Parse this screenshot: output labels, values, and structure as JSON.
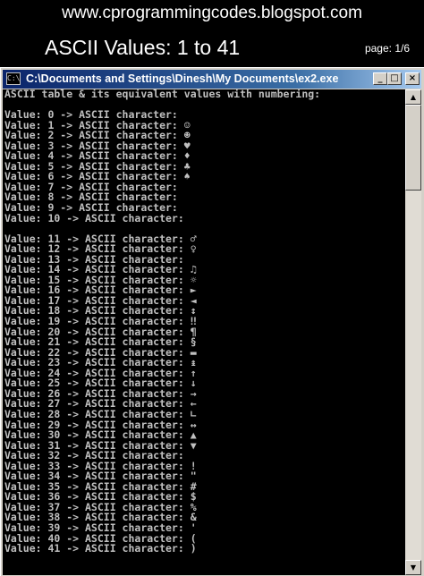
{
  "site_banner": "www.cprogrammingcodes.blogspot.com",
  "slide": {
    "title": "ASCII Values: 1 to 41",
    "page": "page: 1/6"
  },
  "window": {
    "icon_text": "C:\\",
    "title": "C:\\Documents and Settings\\Dinesh\\My Documents\\ex2.exe",
    "minimize_glyph": "_",
    "maximize_glyph": "□",
    "close_glyph": "×"
  },
  "scrollbar": {
    "up_glyph": "▲",
    "down_glyph": "▼"
  },
  "console_lines": [
    "ASCII table & its equivalent values with numbering:",
    "",
    "Value: 0 -> ASCII character:",
    "Value: 1 -> ASCII character: ☺",
    "Value: 2 -> ASCII character: ☻",
    "Value: 3 -> ASCII character: ♥",
    "Value: 4 -> ASCII character: ♦",
    "Value: 5 -> ASCII character: ♣",
    "Value: 6 -> ASCII character: ♠",
    "Value: 7 -> ASCII character:",
    "Value: 8 -> ASCII character:",
    "Value: 9 -> ASCII character:",
    "Value: 10 -> ASCII character:",
    "",
    "Value: 11 -> ASCII character: ♂",
    "Value: 12 -> ASCII character: ♀",
    "Value: 13 -> ASCII character:",
    "Value: 14 -> ASCII character: ♫",
    "Value: 15 -> ASCII character: ☼",
    "Value: 16 -> ASCII character: ►",
    "Value: 17 -> ASCII character: ◄",
    "Value: 18 -> ASCII character: ↕",
    "Value: 19 -> ASCII character: ‼",
    "Value: 20 -> ASCII character: ¶",
    "Value: 21 -> ASCII character: §",
    "Value: 22 -> ASCII character: ▬",
    "Value: 23 -> ASCII character: ↨",
    "Value: 24 -> ASCII character: ↑",
    "Value: 25 -> ASCII character: ↓",
    "Value: 26 -> ASCII character: →",
    "Value: 27 -> ASCII character: ←",
    "Value: 28 -> ASCII character: ∟",
    "Value: 29 -> ASCII character: ↔",
    "Value: 30 -> ASCII character: ▲",
    "Value: 31 -> ASCII character: ▼",
    "Value: 32 -> ASCII character:",
    "Value: 33 -> ASCII character: !",
    "Value: 34 -> ASCII character: \"",
    "Value: 35 -> ASCII character: #",
    "Value: 36 -> ASCII character: $",
    "Value: 37 -> ASCII character: %",
    "Value: 38 -> ASCII character: &",
    "Value: 39 -> ASCII character: '",
    "Value: 40 -> ASCII character: (",
    "Value: 41 -> ASCII character: )"
  ]
}
